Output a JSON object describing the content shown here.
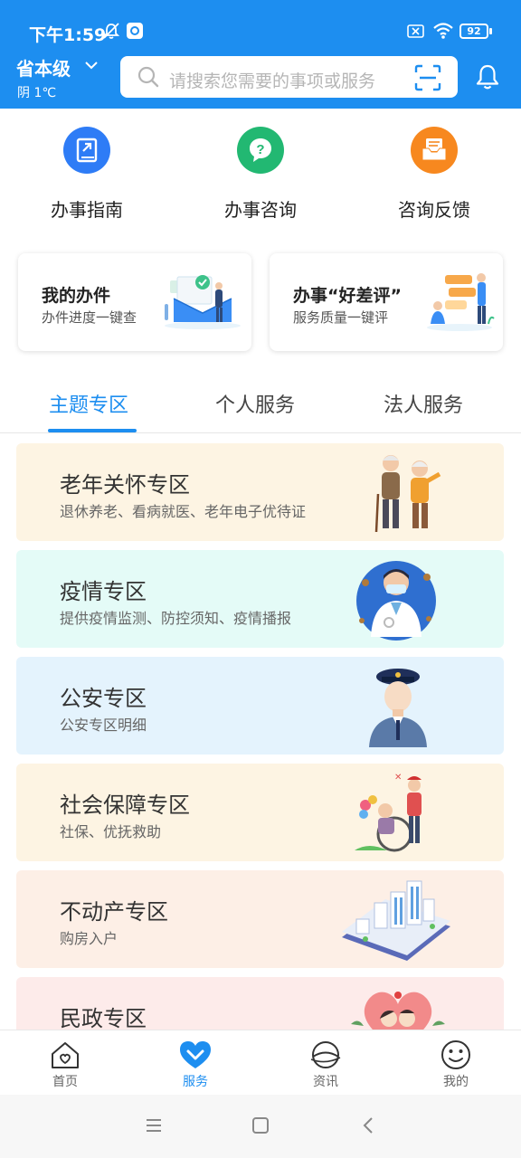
{
  "status_bar": {
    "time": "下午1:59",
    "battery": "92"
  },
  "header": {
    "region": "省本级",
    "weather": "阴 1℃",
    "search_placeholder": "请搜索您需要的事项或服务"
  },
  "quick_actions": [
    {
      "label": "办事指南",
      "color": "#2e7cf6",
      "icon": "book-icon"
    },
    {
      "label": "办事咨询",
      "color": "#22b872",
      "icon": "question-icon"
    },
    {
      "label": "咨询反馈",
      "color": "#f7881f",
      "icon": "inbox-icon"
    }
  ],
  "cards": [
    {
      "title": "我的办件",
      "subtitle": "办件进度一键查"
    },
    {
      "title": "办事“好差评”",
      "subtitle": "服务质量一键评"
    }
  ],
  "tabs": [
    {
      "label": "主题专区",
      "active": true
    },
    {
      "label": "个人服务",
      "active": false
    },
    {
      "label": "法人服务",
      "active": false
    }
  ],
  "zones": [
    {
      "title": "老年关怀专区",
      "subtitle": "退休养老、看病就医、老年电子优待证",
      "bg": "#fdf4e3"
    },
    {
      "title": "疫情专区",
      "subtitle": "提供疫情监测、防控须知、疫情播报",
      "bg": "#e4fbf7"
    },
    {
      "title": "公安专区",
      "subtitle": "公安专区明细",
      "bg": "#e4f3fd"
    },
    {
      "title": "社会保障专区",
      "subtitle": "社保、优抚救助",
      "bg": "#fdf4e3"
    },
    {
      "title": "不动产专区",
      "subtitle": "购房入户",
      "bg": "#fdefe6"
    },
    {
      "title": "民政专区",
      "subtitle": "",
      "bg": "#fdebea"
    }
  ],
  "bottom_nav": [
    {
      "label": "首页",
      "active": false
    },
    {
      "label": "服务",
      "active": true
    },
    {
      "label": "资讯",
      "active": false
    },
    {
      "label": "我的",
      "active": false
    }
  ],
  "colors": {
    "primary": "#1d8ef0"
  }
}
